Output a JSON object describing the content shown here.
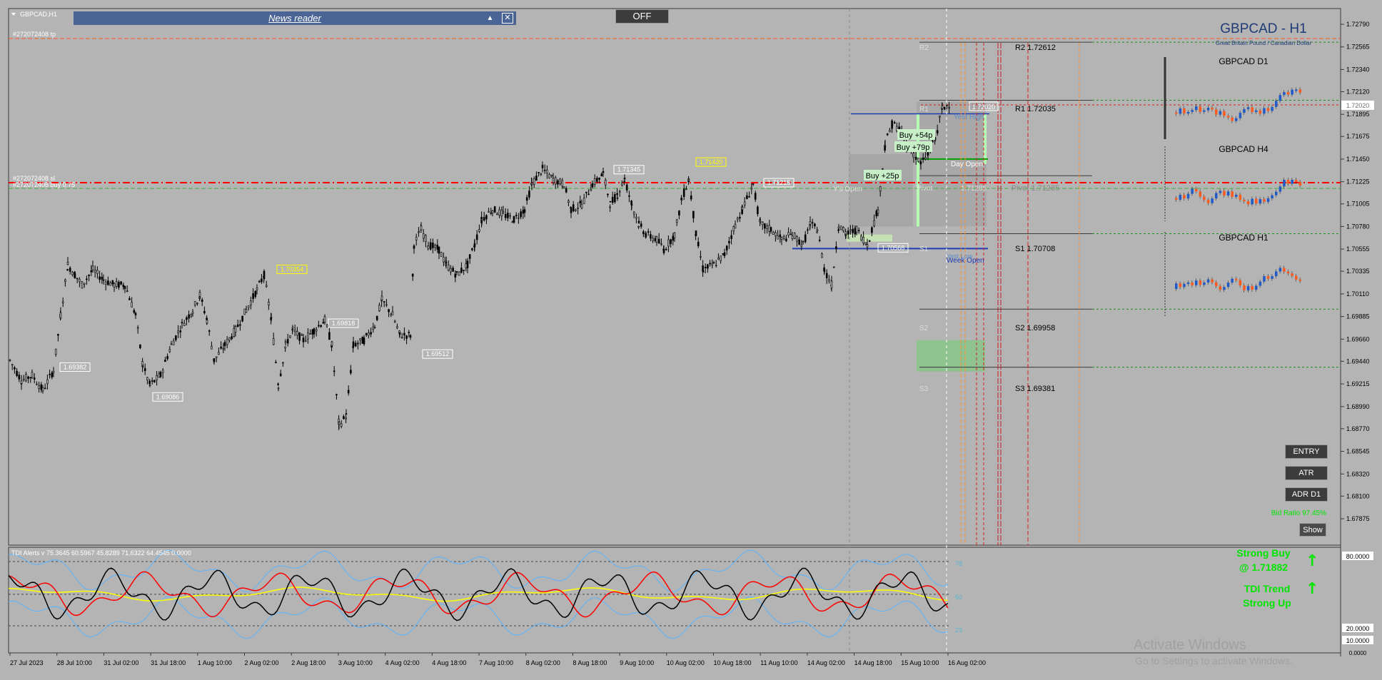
{
  "window": {
    "title": "GBPCAD,H1"
  },
  "news_panel": {
    "label": "News reader",
    "collapse_icon": "triangle-up-icon",
    "close_icon": "close-icon"
  },
  "toggle_button": {
    "label": "OFF"
  },
  "header": {
    "symbol_title": "GBPCAD - H1",
    "subtitle": "Great Britain Pound / Canadian Dollar"
  },
  "order_labels": {
    "tp": "#272072408 tp",
    "sl": "#272072408 sl",
    "buy": "#272072408 buy 0.75"
  },
  "price_axis": [
    "1.72790",
    "1.72565",
    "1.72340",
    "1.72120",
    "1.71895",
    "1.71675",
    "1.71450",
    "1.71225",
    "1.71005",
    "1.70780",
    "1.70555",
    "1.70335",
    "1.70110",
    "1.69885",
    "1.69660",
    "1.69440",
    "1.69215",
    "1.68990",
    "1.68770",
    "1.68545",
    "1.68320",
    "1.68100",
    "1.67875"
  ],
  "current_price": "1.72020",
  "time_axis": [
    "27 Jul 2023",
    "28 Jul 10:00",
    "31 Jul 02:00",
    "31 Jul 18:00",
    "1 Aug 10:00",
    "2 Aug 02:00",
    "2 Aug 18:00",
    "3 Aug 10:00",
    "4 Aug 02:00",
    "4 Aug 18:00",
    "7 Aug 10:00",
    "8 Aug 02:00",
    "8 Aug 18:00",
    "9 Aug 10:00",
    "10 Aug 02:00",
    "10 Aug 18:00",
    "11 Aug 10:00",
    "14 Aug 02:00",
    "14 Aug 18:00",
    "15 Aug 10:00",
    "16 Aug 02:00"
  ],
  "swing_labels": [
    "1.69382",
    "1.69086",
    "1.70354",
    "1.69818",
    "1.69512",
    "1.71345",
    "1.71420",
    "1.71215",
    "1.70568"
  ],
  "pivot_levels": {
    "r2": "R2 1.72612",
    "r1": "R1 1.72035",
    "pivot": "Pivot 1.71285",
    "s1": "S1 1.70708",
    "s2": "S2 1.69958",
    "s3": "S3 1.69381",
    "r2_short": "R2",
    "r1_short": "R1",
    "pivot_short": "Pivot",
    "s1_short": "S1",
    "s2_short": "S2",
    "s3_short": "S3",
    "pivot_mid": "1.71285"
  },
  "session_labels": {
    "yest_high": "Yest High",
    "day_open": "Day Open",
    "ys_open": "Y's Open",
    "week_open": "Week Open",
    "yest_low": "Yest Low",
    "yest_high_price": "1.72020"
  },
  "trade_badges": [
    "Buy +54p",
    "Buy +79p",
    "Buy +25p"
  ],
  "mini_charts": [
    {
      "title": "GBPCAD D1"
    },
    {
      "title": "GBPCAD H4"
    },
    {
      "title": "GBPCAD H1"
    }
  ],
  "side_buttons": [
    "ENTRY",
    "ATR",
    "ADR D1"
  ],
  "bid_ratio": "Bid Ratio 97.45%",
  "show_button": "Show",
  "tdi": {
    "header": "TDI Alerts v 75.3645 60.5967 45.8289 71.6322 64.4545 0.0000",
    "levels": [
      "78",
      "50",
      "23"
    ],
    "axis": [
      "80.0000",
      "20.0000",
      "10.0000",
      "0.0000"
    ]
  },
  "signals": {
    "signal1_line1": "Strong Buy",
    "signal1_line2": "@ 1.71882",
    "signal2_line1": "TDI Trend",
    "signal2_line2": "Strong Up",
    "arrow_icon": "arrow-up-icon"
  },
  "watermark": {
    "line1": "Activate Windows",
    "line2": "Go to Settings to activate Windows."
  },
  "colors": {
    "background": "#b4b4b4",
    "candle": "#000000",
    "tp_line": "#ff5a1e",
    "sl_line": "#ff0000",
    "pivot_green": "#00a000",
    "buy_line": "#ff0000",
    "tdi_rsi": "#000000",
    "tdi_signal": "#ff0000",
    "tdi_market": "#ffff00",
    "tdi_band": "#5ab4ff",
    "strong_green": "#00e600",
    "mini_bull": "#1f5ac8",
    "mini_bear": "#ff5a1e"
  }
}
